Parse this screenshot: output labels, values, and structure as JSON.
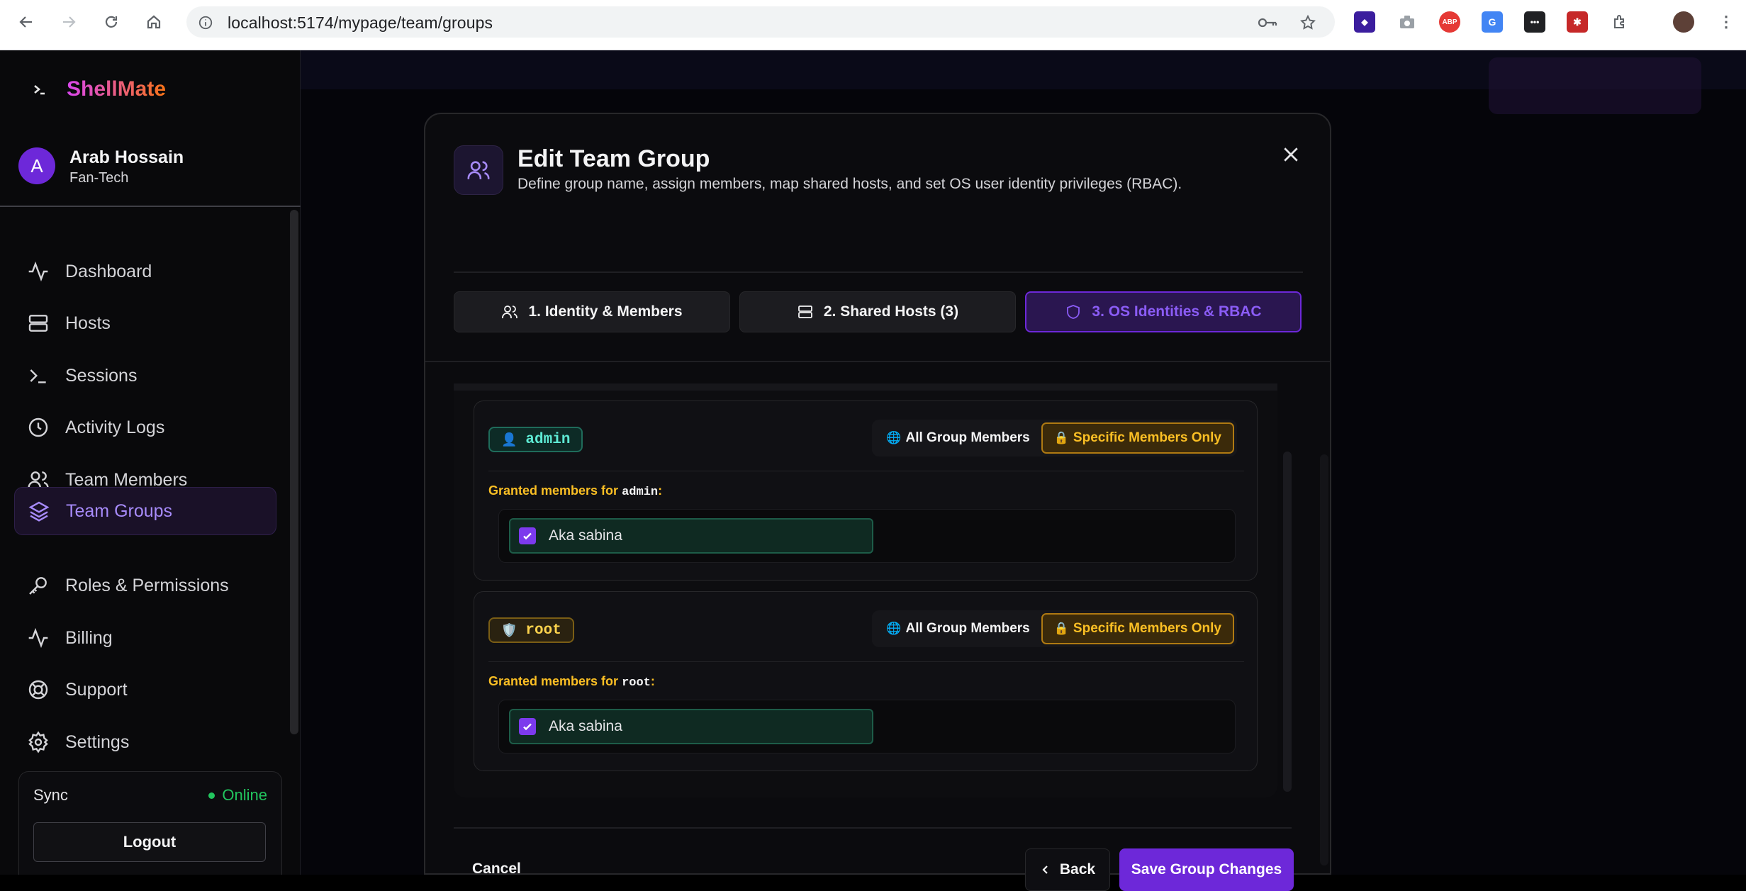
{
  "browser": {
    "url": "localhost:5174/mypage/team/groups"
  },
  "brand": {
    "name": "ShellMate"
  },
  "user": {
    "initial": "A",
    "name": "Arab Hossain",
    "org": "Fan-Tech"
  },
  "sidebar": {
    "items": [
      {
        "label": "Dashboard",
        "icon": "activity-icon"
      },
      {
        "label": "Hosts",
        "icon": "server-icon"
      },
      {
        "label": "Sessions",
        "icon": "terminal-icon"
      },
      {
        "label": "Activity Logs",
        "icon": "clock-icon"
      },
      {
        "label": "Team Members",
        "icon": "users-icon"
      },
      {
        "label": "Team Groups",
        "icon": "layers-icon",
        "active": true
      },
      {
        "label": "Roles & Permissions",
        "icon": "key-icon"
      },
      {
        "label": "Billing",
        "icon": "activity-icon"
      },
      {
        "label": "Support",
        "icon": "lifebuoy-icon"
      },
      {
        "label": "Settings",
        "icon": "gear-icon"
      }
    ],
    "sync_label": "Sync",
    "sync_status": "Online",
    "logout_label": "Logout"
  },
  "modal": {
    "title": "Edit Team Group",
    "subtitle": "Define group name, assign members, map shared hosts, and set OS user identity privileges (RBAC).",
    "tabs": [
      {
        "label": "1. Identity & Members",
        "active": false
      },
      {
        "label": "2. Shared Hosts (3)",
        "active": false
      },
      {
        "label": "3. OS Identities & RBAC",
        "active": true
      }
    ],
    "identities": [
      {
        "name": "admin",
        "glyph": "👤",
        "option_all": "All Group Members",
        "option_specific": "Specific Members Only",
        "selected": "specific",
        "granted_prefix": "Granted members for",
        "members": [
          {
            "name": "Aka sabina",
            "checked": true
          }
        ]
      },
      {
        "name": "root",
        "glyph": "🛡️",
        "option_all": "All Group Members",
        "option_specific": "Specific Members Only",
        "selected": "specific",
        "granted_prefix": "Granted members for",
        "members": [
          {
            "name": "Aka sabina",
            "checked": true
          }
        ]
      }
    ],
    "cancel_label": "Cancel",
    "back_label": "Back",
    "save_label": "Save Group Changes"
  },
  "colors": {
    "accent": "#6d28d9",
    "accent_text": "#8b5cf6",
    "amber": "#fbbf24",
    "online": "#22c55e"
  }
}
